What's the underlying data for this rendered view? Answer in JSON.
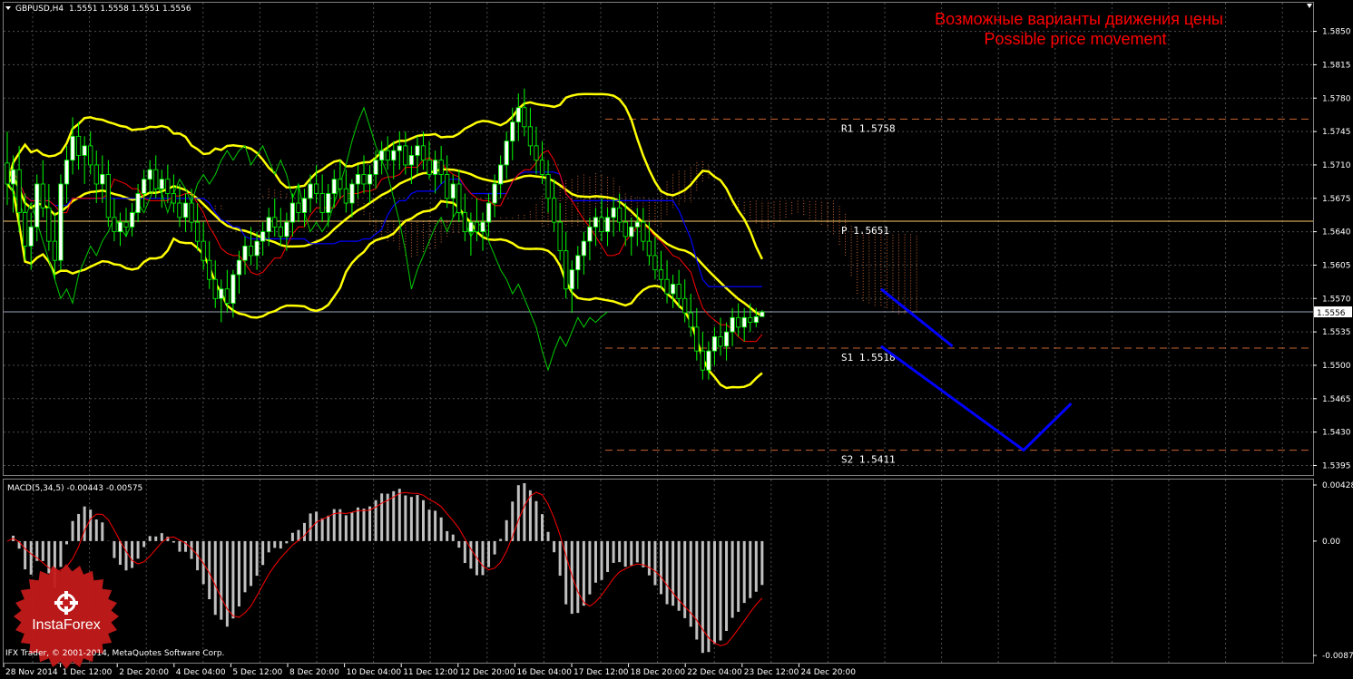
{
  "header": {
    "symbol": "GBPUSD,H4",
    "ohlc": "1.5551 1.5558 1.5551 1.5556",
    "macd_label": "MACD(5,34,5) -0.00443 -0.00575"
  },
  "overlay": {
    "title_ru": "Возможные варианты движения цены",
    "title_en": "Possible price movement",
    "copyright": "IFX Trader, © 2001-2014, MetaQuotes Software Corp.",
    "logo_text": "InstaForex"
  },
  "colors": {
    "background": "#000000",
    "grid": "#4d4d4d",
    "bollinger": "#ffff00",
    "bull_candle": "#ffffff",
    "bear_candle": "#000000",
    "candle_wick": "#00ff00",
    "kijun": "#0000ff",
    "tenkan": "#ff0000",
    "chikou": "#00cc00",
    "forecast": "#0000ff",
    "level_line": "#c86432",
    "pivot_line": "#ffcc66",
    "macd_hist": "#c0c0c0",
    "macd_signal": "#ff0000",
    "title_text": "#ff0000"
  },
  "chart_data": [
    {
      "type": "candlestick",
      "name": "GBPUSD,H4",
      "y_ticks": [
        1.585,
        1.5815,
        1.578,
        1.5745,
        1.571,
        1.5675,
        1.564,
        1.5605,
        1.557,
        1.5535,
        1.55,
        1.5465,
        1.543,
        1.5395
      ],
      "ylim": [
        1.5385,
        1.588
      ],
      "x_ticks": [
        "28 Nov 2014",
        "1 Dec 12:00",
        "2 Dec 20:00",
        "4 Dec 04:00",
        "5 Dec 12:00",
        "8 Dec 20:00",
        "10 Dec 04:00",
        "11 Dec 12:00",
        "12 Dec 20:00",
        "16 Dec 04:00",
        "17 Dec 12:00",
        "18 Dec 20:00",
        "22 Dec 04:00",
        "23 Dec 12:00",
        "24 Dec 20:00"
      ],
      "current_price": 1.5556,
      "current_price_label": "1.5556",
      "levels": [
        {
          "label": "R1 1.5758",
          "price": 1.5758,
          "style": "dashed"
        },
        {
          "label": "P 1.5651",
          "price": 1.5651,
          "style": "solid"
        },
        {
          "label": "S1 1.5518",
          "price": 1.5518,
          "style": "dashed"
        },
        {
          "label": "S2 1.5411",
          "price": 1.5411,
          "style": "dashed"
        }
      ],
      "forecast_path": [
        {
          "bar": 147,
          "price": 1.558
        },
        {
          "bar": 159,
          "price": 1.552
        },
        {
          "bar": 147,
          "price": 1.552
        },
        {
          "bar": 171,
          "price": 1.5411
        },
        {
          "bar": 179,
          "price": 1.546
        }
      ],
      "candles": [
        {
          "o": 1.5712,
          "h": 1.5745,
          "l": 1.5668,
          "c": 1.569
        },
        {
          "o": 1.569,
          "h": 1.572,
          "l": 1.566,
          "c": 1.5705
        },
        {
          "o": 1.5705,
          "h": 1.573,
          "l": 1.564,
          "c": 1.566
        },
        {
          "o": 1.566,
          "h": 1.568,
          "l": 1.561,
          "c": 1.5625
        },
        {
          "o": 1.5625,
          "h": 1.566,
          "l": 1.56,
          "c": 1.5645
        },
        {
          "o": 1.5645,
          "h": 1.57,
          "l": 1.563,
          "c": 1.569
        },
        {
          "o": 1.569,
          "h": 1.5715,
          "l": 1.5655,
          "c": 1.5665
        },
        {
          "o": 1.5665,
          "h": 1.569,
          "l": 1.562,
          "c": 1.563
        },
        {
          "o": 1.563,
          "h": 1.566,
          "l": 1.559,
          "c": 1.561
        },
        {
          "o": 1.561,
          "h": 1.57,
          "l": 1.56,
          "c": 1.569
        },
        {
          "o": 1.569,
          "h": 1.573,
          "l": 1.567,
          "c": 1.5715
        },
        {
          "o": 1.5715,
          "h": 1.576,
          "l": 1.57,
          "c": 1.574
        },
        {
          "o": 1.574,
          "h": 1.5755,
          "l": 1.5705,
          "c": 1.572
        },
        {
          "o": 1.572,
          "h": 1.574,
          "l": 1.569,
          "c": 1.573
        },
        {
          "o": 1.573,
          "h": 1.5745,
          "l": 1.57,
          "c": 1.571
        },
        {
          "o": 1.571,
          "h": 1.5725,
          "l": 1.567,
          "c": 1.569
        },
        {
          "o": 1.569,
          "h": 1.572,
          "l": 1.567,
          "c": 1.57
        },
        {
          "o": 1.57,
          "h": 1.5715,
          "l": 1.5645,
          "c": 1.5655
        },
        {
          "o": 1.5655,
          "h": 1.5675,
          "l": 1.563,
          "c": 1.564
        },
        {
          "o": 1.564,
          "h": 1.566,
          "l": 1.5625,
          "c": 1.565
        },
        {
          "o": 1.565,
          "h": 1.5665,
          "l": 1.5635,
          "c": 1.5645
        },
        {
          "o": 1.5645,
          "h": 1.567,
          "l": 1.5635,
          "c": 1.566
        },
        {
          "o": 1.566,
          "h": 1.569,
          "l": 1.565,
          "c": 1.568
        },
        {
          "o": 1.568,
          "h": 1.5705,
          "l": 1.5665,
          "c": 1.5695
        },
        {
          "o": 1.5695,
          "h": 1.5715,
          "l": 1.568,
          "c": 1.5705
        },
        {
          "o": 1.5705,
          "h": 1.572,
          "l": 1.5675,
          "c": 1.5685
        },
        {
          "o": 1.5685,
          "h": 1.5705,
          "l": 1.5665,
          "c": 1.5695
        },
        {
          "o": 1.5695,
          "h": 1.571,
          "l": 1.567,
          "c": 1.568
        },
        {
          "o": 1.568,
          "h": 1.57,
          "l": 1.566,
          "c": 1.567
        },
        {
          "o": 1.567,
          "h": 1.569,
          "l": 1.5645,
          "c": 1.5655
        },
        {
          "o": 1.5655,
          "h": 1.568,
          "l": 1.564,
          "c": 1.567
        },
        {
          "o": 1.567,
          "h": 1.5685,
          "l": 1.564,
          "c": 1.565
        },
        {
          "o": 1.565,
          "h": 1.567,
          "l": 1.562,
          "c": 1.563
        },
        {
          "o": 1.563,
          "h": 1.565,
          "l": 1.56,
          "c": 1.561
        },
        {
          "o": 1.561,
          "h": 1.563,
          "l": 1.558,
          "c": 1.559
        },
        {
          "o": 1.559,
          "h": 1.561,
          "l": 1.556,
          "c": 1.557
        },
        {
          "o": 1.557,
          "h": 1.559,
          "l": 1.5545,
          "c": 1.558
        },
        {
          "o": 1.558,
          "h": 1.56,
          "l": 1.5555,
          "c": 1.5565
        },
        {
          "o": 1.5565,
          "h": 1.56,
          "l": 1.555,
          "c": 1.5595
        },
        {
          "o": 1.5595,
          "h": 1.562,
          "l": 1.5575,
          "c": 1.561
        },
        {
          "o": 1.561,
          "h": 1.5635,
          "l": 1.5595,
          "c": 1.5625
        },
        {
          "o": 1.5625,
          "h": 1.5645,
          "l": 1.5605,
          "c": 1.5615
        },
        {
          "o": 1.5615,
          "h": 1.564,
          "l": 1.56,
          "c": 1.563
        },
        {
          "o": 1.563,
          "h": 1.565,
          "l": 1.5615,
          "c": 1.564
        },
        {
          "o": 1.564,
          "h": 1.5665,
          "l": 1.5625,
          "c": 1.5655
        },
        {
          "o": 1.5655,
          "h": 1.5675,
          "l": 1.5635,
          "c": 1.5645
        },
        {
          "o": 1.5645,
          "h": 1.5665,
          "l": 1.5625,
          "c": 1.5635
        },
        {
          "o": 1.5635,
          "h": 1.566,
          "l": 1.562,
          "c": 1.565
        },
        {
          "o": 1.565,
          "h": 1.568,
          "l": 1.5635,
          "c": 1.567
        },
        {
          "o": 1.567,
          "h": 1.569,
          "l": 1.565,
          "c": 1.566
        },
        {
          "o": 1.566,
          "h": 1.5685,
          "l": 1.5645,
          "c": 1.5675
        },
        {
          "o": 1.5675,
          "h": 1.57,
          "l": 1.566,
          "c": 1.569
        },
        {
          "o": 1.569,
          "h": 1.571,
          "l": 1.567,
          "c": 1.568
        },
        {
          "o": 1.568,
          "h": 1.57,
          "l": 1.565,
          "c": 1.566
        },
        {
          "o": 1.566,
          "h": 1.569,
          "l": 1.5645,
          "c": 1.568
        },
        {
          "o": 1.568,
          "h": 1.5705,
          "l": 1.5665,
          "c": 1.5695
        },
        {
          "o": 1.5695,
          "h": 1.5715,
          "l": 1.5675,
          "c": 1.5685
        },
        {
          "o": 1.5685,
          "h": 1.5705,
          "l": 1.566,
          "c": 1.567
        },
        {
          "o": 1.567,
          "h": 1.5695,
          "l": 1.5655,
          "c": 1.569
        },
        {
          "o": 1.569,
          "h": 1.571,
          "l": 1.5675,
          "c": 1.57
        },
        {
          "o": 1.57,
          "h": 1.572,
          "l": 1.568,
          "c": 1.569
        },
        {
          "o": 1.569,
          "h": 1.571,
          "l": 1.567,
          "c": 1.57
        },
        {
          "o": 1.57,
          "h": 1.5725,
          "l": 1.5685,
          "c": 1.5715
        },
        {
          "o": 1.5715,
          "h": 1.5735,
          "l": 1.57,
          "c": 1.5725
        },
        {
          "o": 1.5725,
          "h": 1.574,
          "l": 1.5705,
          "c": 1.5715
        },
        {
          "o": 1.5715,
          "h": 1.5735,
          "l": 1.5695,
          "c": 1.5725
        },
        {
          "o": 1.5725,
          "h": 1.5745,
          "l": 1.5705,
          "c": 1.573
        },
        {
          "o": 1.573,
          "h": 1.5745,
          "l": 1.57,
          "c": 1.571
        },
        {
          "o": 1.571,
          "h": 1.573,
          "l": 1.569,
          "c": 1.572
        },
        {
          "o": 1.572,
          "h": 1.574,
          "l": 1.57,
          "c": 1.573
        },
        {
          "o": 1.573,
          "h": 1.5745,
          "l": 1.5705,
          "c": 1.5715
        },
        {
          "o": 1.5715,
          "h": 1.5735,
          "l": 1.5695,
          "c": 1.57
        },
        {
          "o": 1.57,
          "h": 1.5725,
          "l": 1.568,
          "c": 1.5715
        },
        {
          "o": 1.5715,
          "h": 1.573,
          "l": 1.569,
          "c": 1.57
        },
        {
          "o": 1.57,
          "h": 1.572,
          "l": 1.5665,
          "c": 1.5675
        },
        {
          "o": 1.5675,
          "h": 1.57,
          "l": 1.5655,
          "c": 1.569
        },
        {
          "o": 1.569,
          "h": 1.5705,
          "l": 1.565,
          "c": 1.566
        },
        {
          "o": 1.566,
          "h": 1.568,
          "l": 1.563,
          "c": 1.564
        },
        {
          "o": 1.564,
          "h": 1.566,
          "l": 1.5615,
          "c": 1.565
        },
        {
          "o": 1.565,
          "h": 1.5675,
          "l": 1.563,
          "c": 1.564
        },
        {
          "o": 1.564,
          "h": 1.566,
          "l": 1.562,
          "c": 1.565
        },
        {
          "o": 1.565,
          "h": 1.568,
          "l": 1.5635,
          "c": 1.567
        },
        {
          "o": 1.567,
          "h": 1.57,
          "l": 1.5655,
          "c": 1.569
        },
        {
          "o": 1.569,
          "h": 1.572,
          "l": 1.5675,
          "c": 1.571
        },
        {
          "o": 1.571,
          "h": 1.5745,
          "l": 1.5695,
          "c": 1.5735
        },
        {
          "o": 1.5735,
          "h": 1.577,
          "l": 1.5715,
          "c": 1.5755
        },
        {
          "o": 1.5755,
          "h": 1.5785,
          "l": 1.5735,
          "c": 1.577
        },
        {
          "o": 1.577,
          "h": 1.579,
          "l": 1.574,
          "c": 1.575
        },
        {
          "o": 1.575,
          "h": 1.577,
          "l": 1.572,
          "c": 1.573
        },
        {
          "o": 1.573,
          "h": 1.575,
          "l": 1.57,
          "c": 1.5715
        },
        {
          "o": 1.5715,
          "h": 1.5735,
          "l": 1.569,
          "c": 1.57
        },
        {
          "o": 1.57,
          "h": 1.5715,
          "l": 1.566,
          "c": 1.5675
        },
        {
          "o": 1.5675,
          "h": 1.5695,
          "l": 1.564,
          "c": 1.565
        },
        {
          "o": 1.565,
          "h": 1.567,
          "l": 1.561,
          "c": 1.562
        },
        {
          "o": 1.562,
          "h": 1.564,
          "l": 1.557,
          "c": 1.558
        },
        {
          "o": 1.558,
          "h": 1.561,
          "l": 1.5555,
          "c": 1.56
        },
        {
          "o": 1.56,
          "h": 1.5625,
          "l": 1.558,
          "c": 1.5615
        },
        {
          "o": 1.5615,
          "h": 1.564,
          "l": 1.5595,
          "c": 1.563
        },
        {
          "o": 1.563,
          "h": 1.5655,
          "l": 1.561,
          "c": 1.5645
        },
        {
          "o": 1.5645,
          "h": 1.5665,
          "l": 1.5625,
          "c": 1.5655
        },
        {
          "o": 1.5655,
          "h": 1.5675,
          "l": 1.563,
          "c": 1.564
        },
        {
          "o": 1.564,
          "h": 1.5665,
          "l": 1.5625,
          "c": 1.5655
        },
        {
          "o": 1.5655,
          "h": 1.5675,
          "l": 1.5635,
          "c": 1.5665
        },
        {
          "o": 1.5665,
          "h": 1.568,
          "l": 1.564,
          "c": 1.565
        },
        {
          "o": 1.565,
          "h": 1.567,
          "l": 1.5625,
          "c": 1.5635
        },
        {
          "o": 1.5635,
          "h": 1.5655,
          "l": 1.5615,
          "c": 1.5645
        },
        {
          "o": 1.5645,
          "h": 1.5665,
          "l": 1.5625,
          "c": 1.565
        },
        {
          "o": 1.565,
          "h": 1.5665,
          "l": 1.562,
          "c": 1.563
        },
        {
          "o": 1.563,
          "h": 1.565,
          "l": 1.5605,
          "c": 1.5615
        },
        {
          "o": 1.5615,
          "h": 1.5635,
          "l": 1.559,
          "c": 1.56
        },
        {
          "o": 1.56,
          "h": 1.562,
          "l": 1.558,
          "c": 1.559
        },
        {
          "o": 1.559,
          "h": 1.561,
          "l": 1.5565,
          "c": 1.5575
        },
        {
          "o": 1.5575,
          "h": 1.5595,
          "l": 1.556,
          "c": 1.5585
        },
        {
          "o": 1.5585,
          "h": 1.56,
          "l": 1.556,
          "c": 1.557
        },
        {
          "o": 1.557,
          "h": 1.559,
          "l": 1.5545,
          "c": 1.5555
        },
        {
          "o": 1.5555,
          "h": 1.5575,
          "l": 1.553,
          "c": 1.554
        },
        {
          "o": 1.554,
          "h": 1.556,
          "l": 1.5505,
          "c": 1.5515
        },
        {
          "o": 1.5515,
          "h": 1.5535,
          "l": 1.5485,
          "c": 1.5495
        },
        {
          "o": 1.5495,
          "h": 1.5525,
          "l": 1.5485,
          "c": 1.5515
        },
        {
          "o": 1.5515,
          "h": 1.554,
          "l": 1.55,
          "c": 1.553
        },
        {
          "o": 1.553,
          "h": 1.555,
          "l": 1.551,
          "c": 1.552
        },
        {
          "o": 1.552,
          "h": 1.5545,
          "l": 1.5505,
          "c": 1.5535
        },
        {
          "o": 1.5535,
          "h": 1.556,
          "l": 1.552,
          "c": 1.555
        },
        {
          "o": 1.555,
          "h": 1.5565,
          "l": 1.553,
          "c": 1.554
        },
        {
          "o": 1.554,
          "h": 1.556,
          "l": 1.5525,
          "c": 1.555
        },
        {
          "o": 1.555,
          "h": 1.5565,
          "l": 1.5535,
          "c": 1.5545
        },
        {
          "o": 1.5545,
          "h": 1.556,
          "l": 1.554,
          "c": 1.5551
        },
        {
          "o": 1.5551,
          "h": 1.5558,
          "l": 1.5551,
          "c": 1.5556
        }
      ]
    },
    {
      "type": "bar",
      "name": "MACD(5,34,5)",
      "value_macd": -0.00443,
      "value_signal": -0.00575,
      "y_ticks": [
        0.00428,
        0.0,
        -0.00872
      ],
      "y_tick_labels": [
        "0.00428",
        "0.00",
        "-0.00872"
      ],
      "ylim": [
        -0.00872,
        0.00428
      ]
    }
  ]
}
